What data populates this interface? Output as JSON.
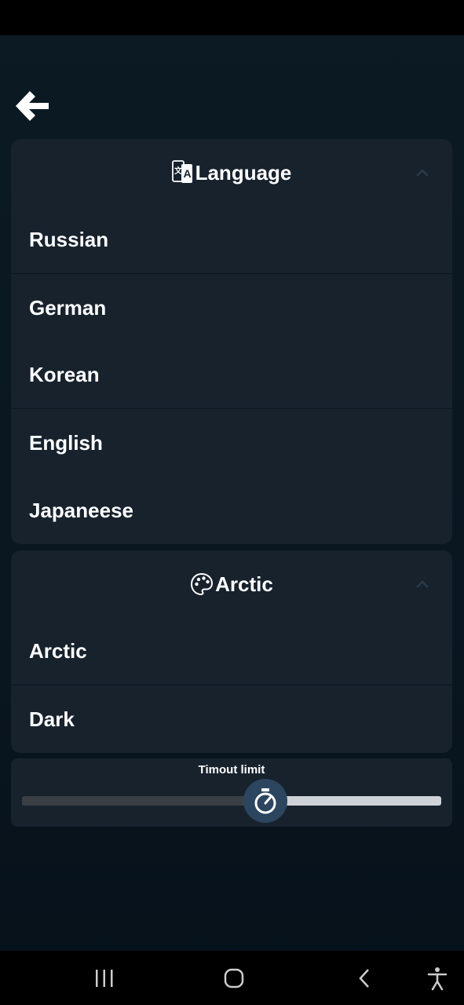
{
  "language_section": {
    "title": "Language",
    "icon": "translate-icon",
    "items": [
      "Russian",
      "German",
      "Korean",
      "English",
      "Japaneese"
    ]
  },
  "theme_section": {
    "title": "Arctic",
    "icon": "palette-icon",
    "items": [
      "Arctic",
      "Dark"
    ]
  },
  "timeout": {
    "label": "Timout limit",
    "value_fraction": 0.58,
    "icon": "stopwatch-icon"
  },
  "colors": {
    "card": "#17222d",
    "thumb": "#2c4660",
    "track_filled": "#3a3f44",
    "track_empty": "#cfd3d7"
  }
}
